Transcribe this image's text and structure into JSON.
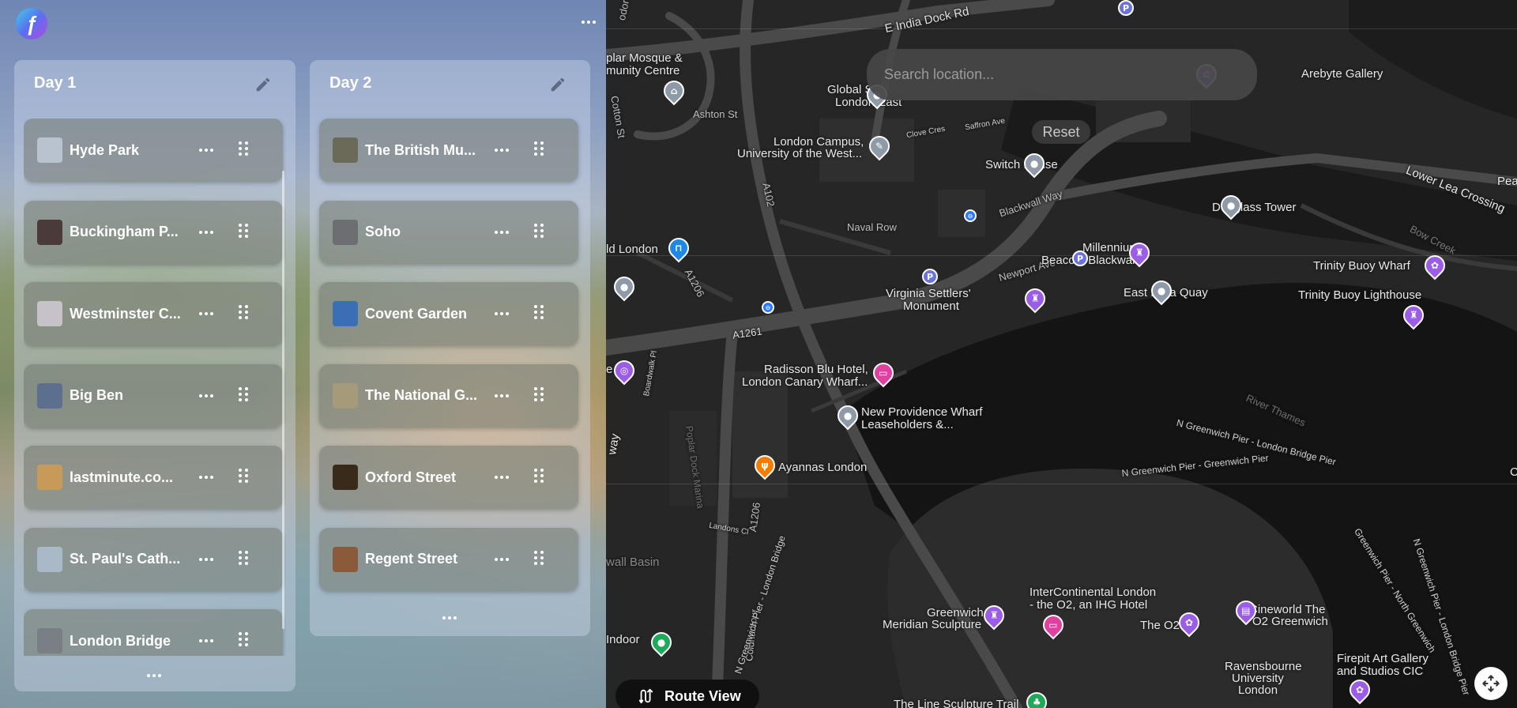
{
  "app": {
    "logo_glyph": "ƒ",
    "menu_icon": "ellipsis-icon"
  },
  "days": [
    {
      "title": "Day 1",
      "places": [
        {
          "name": "Hyde Park",
          "thumb_color": "#b9c3cf"
        },
        {
          "name": "Buckingham P...",
          "thumb_color": "#4a3a3a"
        },
        {
          "name": "Westminster C...",
          "thumb_color": "#c7c2c9"
        },
        {
          "name": "Big Ben",
          "thumb_color": "#5d6f8e"
        },
        {
          "name": "lastminute.co...",
          "thumb_color": "#c89a58"
        },
        {
          "name": "St. Paul's Cath...",
          "thumb_color": "#a9b9c8"
        },
        {
          "name": "London Bridge",
          "thumb_color": "#7a7f86"
        }
      ]
    },
    {
      "title": "Day 2",
      "places": [
        {
          "name": "The British Mu...",
          "thumb_color": "#6b6a58"
        },
        {
          "name": "Soho",
          "thumb_color": "#6d6e71"
        },
        {
          "name": "Covent Garden",
          "thumb_color": "#3a6fb5"
        },
        {
          "name": "The National G...",
          "thumb_color": "#a59a7a"
        },
        {
          "name": "Oxford Street",
          "thumb_color": "#3a2a1a"
        },
        {
          "name": "Regent Street",
          "thumb_color": "#8a5a3a"
        }
      ]
    }
  ],
  "map": {
    "search_placeholder": "Search location...",
    "reset_label": "Reset",
    "route_view_label": "Route View",
    "labels": {
      "e_india_dock_rd": "E India Dock Rd",
      "poplar_mosque": "plar Mosque &",
      "community_centre": "munity Centre",
      "codore_st": "odore St",
      "ashton_st": "Ashton St",
      "cotton_st": "Cotton St",
      "global_s": "Global S",
      "london_east": "London East",
      "london_campus_1": "London Campus,",
      "london_campus_2": "University of the West...",
      "clove_cres": "Clove Cres",
      "saffron_ave": "Saffron Ave",
      "switch_house": "Switch House",
      "blackwall_way": "Blackwall Way",
      "naval_row": "Naval Row",
      "a102": "A102",
      "ld_london": "ld London",
      "a1206_top": "A1206",
      "newport_ave": "Newport Ave",
      "millennium_1": "Millennium",
      "millennium_2": "Beacon, Blackwall",
      "douglass_tower": "Douglass Tower",
      "arebyte": "Arebyte Gallery",
      "lower_lea": "Lower Lea Crossing",
      "peac": "Peac",
      "trinity_wharf": "Trinity Buoy Wharf",
      "trinity_lighthouse": "Trinity Buoy Lighthouse",
      "bow_creek": "Bow Creek",
      "virginia_1": "Virginia Settlers'",
      "virginia_2": "Monument",
      "east_india_quay": "East India Quay",
      "a1261": "A1261",
      "radisson_1": "Radisson Blu Hotel,",
      "radisson_2": "London Canary Wharf...",
      "new_providence_1": "New Providence Wharf",
      "new_providence_2": "Leaseholders &...",
      "river_thames": "River Thames",
      "n_greenwich_pier_lb": "N Greenwich Pier - London Bridge Pier",
      "n_greenwich_pier_gp": "N Greenwich Pier - Greenwich Pier",
      "ayannas": "Ayannas London",
      "poplar_dock": "Poplar Dock Marina",
      "boardwalk": "Boardwalk Pl",
      "landons": "Landons Cl",
      "a1206_bottom": "A1206",
      "wall_basin": "wall Basin",
      "intercontinental_1": "InterContinental London",
      "intercontinental_2": "- the O2, an IHG Hotel",
      "greenwich_1": "Greenwich",
      "greenwich_2": "Meridian Sculpture",
      "the_o2": "The O2",
      "cineworld_1": "Cineworld The",
      "cineworld_2": "O2 Greenwich",
      "ravensbourne_1": "Ravensbourne",
      "ravensbourne_2": "University",
      "ravensbourne_3": "London",
      "firepit_1": "Firepit Art Gallery",
      "firepit_2": "and Studios CIC",
      "indoor": "Indoor",
      "coldharbour": "Coldharbour",
      "line_sculpture": "The Line Sculpture Trail",
      "greenwich_north": "Greenwich Pier - North Greenwich",
      "n_greenwich_lb2": "N Greenwich Pier - London Bridge",
      "nlbp": "N Greenwich Pier - London Bridge Pier",
      "way": "way",
      "e_label": "e",
      "c_label": "C"
    }
  }
}
